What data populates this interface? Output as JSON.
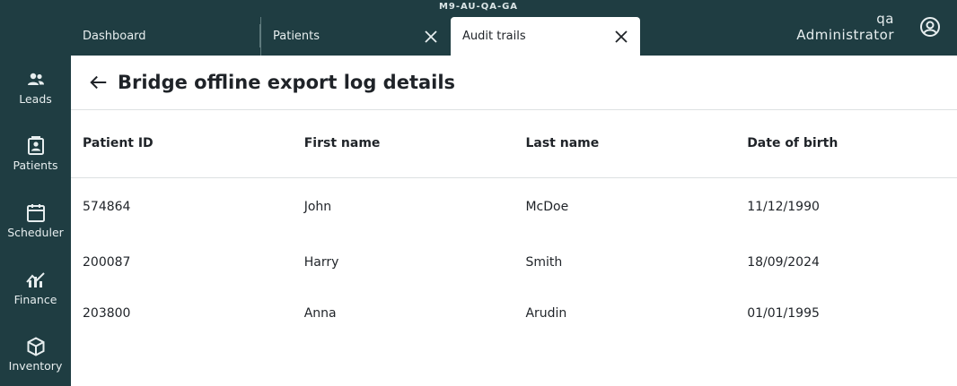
{
  "env_code": "M9-AU-QA-GA",
  "tabs": [
    {
      "label": "Dashboard"
    },
    {
      "label": "Patients"
    },
    {
      "label": "Audit trails"
    }
  ],
  "user": {
    "name": "qa",
    "role": "Administrator"
  },
  "sidebar": {
    "items": [
      {
        "label": "Leads",
        "icon": "people-icon"
      },
      {
        "label": "Patients",
        "icon": "contact-card-icon"
      },
      {
        "label": "Scheduler",
        "icon": "calendar-icon"
      },
      {
        "label": "Finance",
        "icon": "chart-icon"
      },
      {
        "label": "Inventory",
        "icon": "box-icon"
      }
    ]
  },
  "page": {
    "title": "Bridge offline export log details"
  },
  "table": {
    "columns": [
      "Patient ID",
      "First name",
      "Last name",
      "Date of birth"
    ],
    "rows": [
      [
        "574864",
        "John",
        "McDoe",
        "11/12/1990"
      ],
      [
        "200087",
        "Harry",
        "Smith",
        "18/09/2024"
      ],
      [
        "203800",
        "Anna",
        "Arudin",
        "01/01/1995"
      ]
    ]
  },
  "colors": {
    "shell": "#1f3d42",
    "content": "#ffffff",
    "text": "#1f2328"
  }
}
